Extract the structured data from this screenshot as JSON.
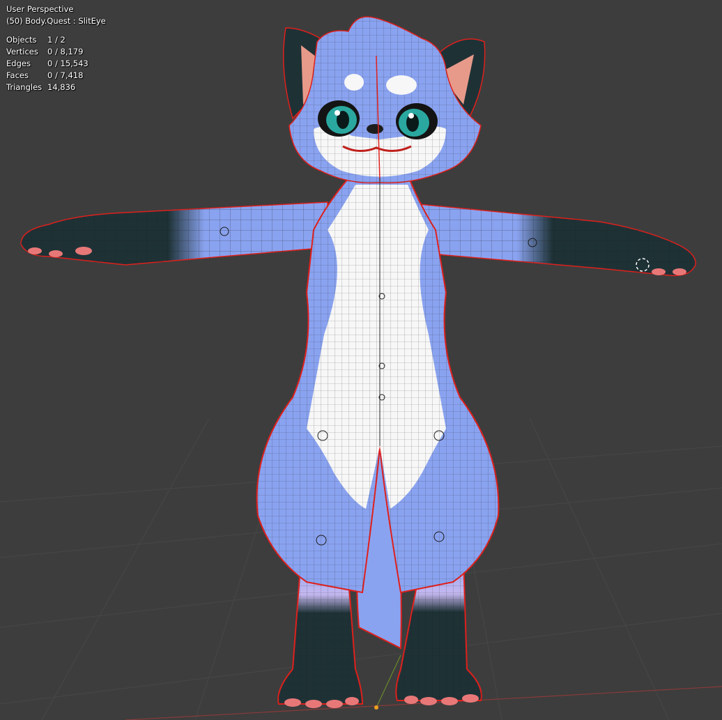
{
  "viewport": {
    "view_name": "User Perspective",
    "object_info": "(50) Body.Quest : SlitEye",
    "colors": {
      "background": "#3d3d3d",
      "grid": "#4a4a4a",
      "fur_blue": "#8aa3f0",
      "fur_white": "#f7f7f7",
      "fur_dark": "#1e3236",
      "seam": "#e0201c",
      "paw_pad": "#e87878",
      "inner_ear": "#e89a8a"
    }
  },
  "stats": [
    {
      "label": "Objects",
      "value": "1 / 2"
    },
    {
      "label": "Vertices",
      "value": "0 / 8,179"
    },
    {
      "label": "Edges",
      "value": "0 / 15,543"
    },
    {
      "label": "Faces",
      "value": "0 / 7,418"
    },
    {
      "label": "Triangles",
      "value": "14,836"
    }
  ]
}
